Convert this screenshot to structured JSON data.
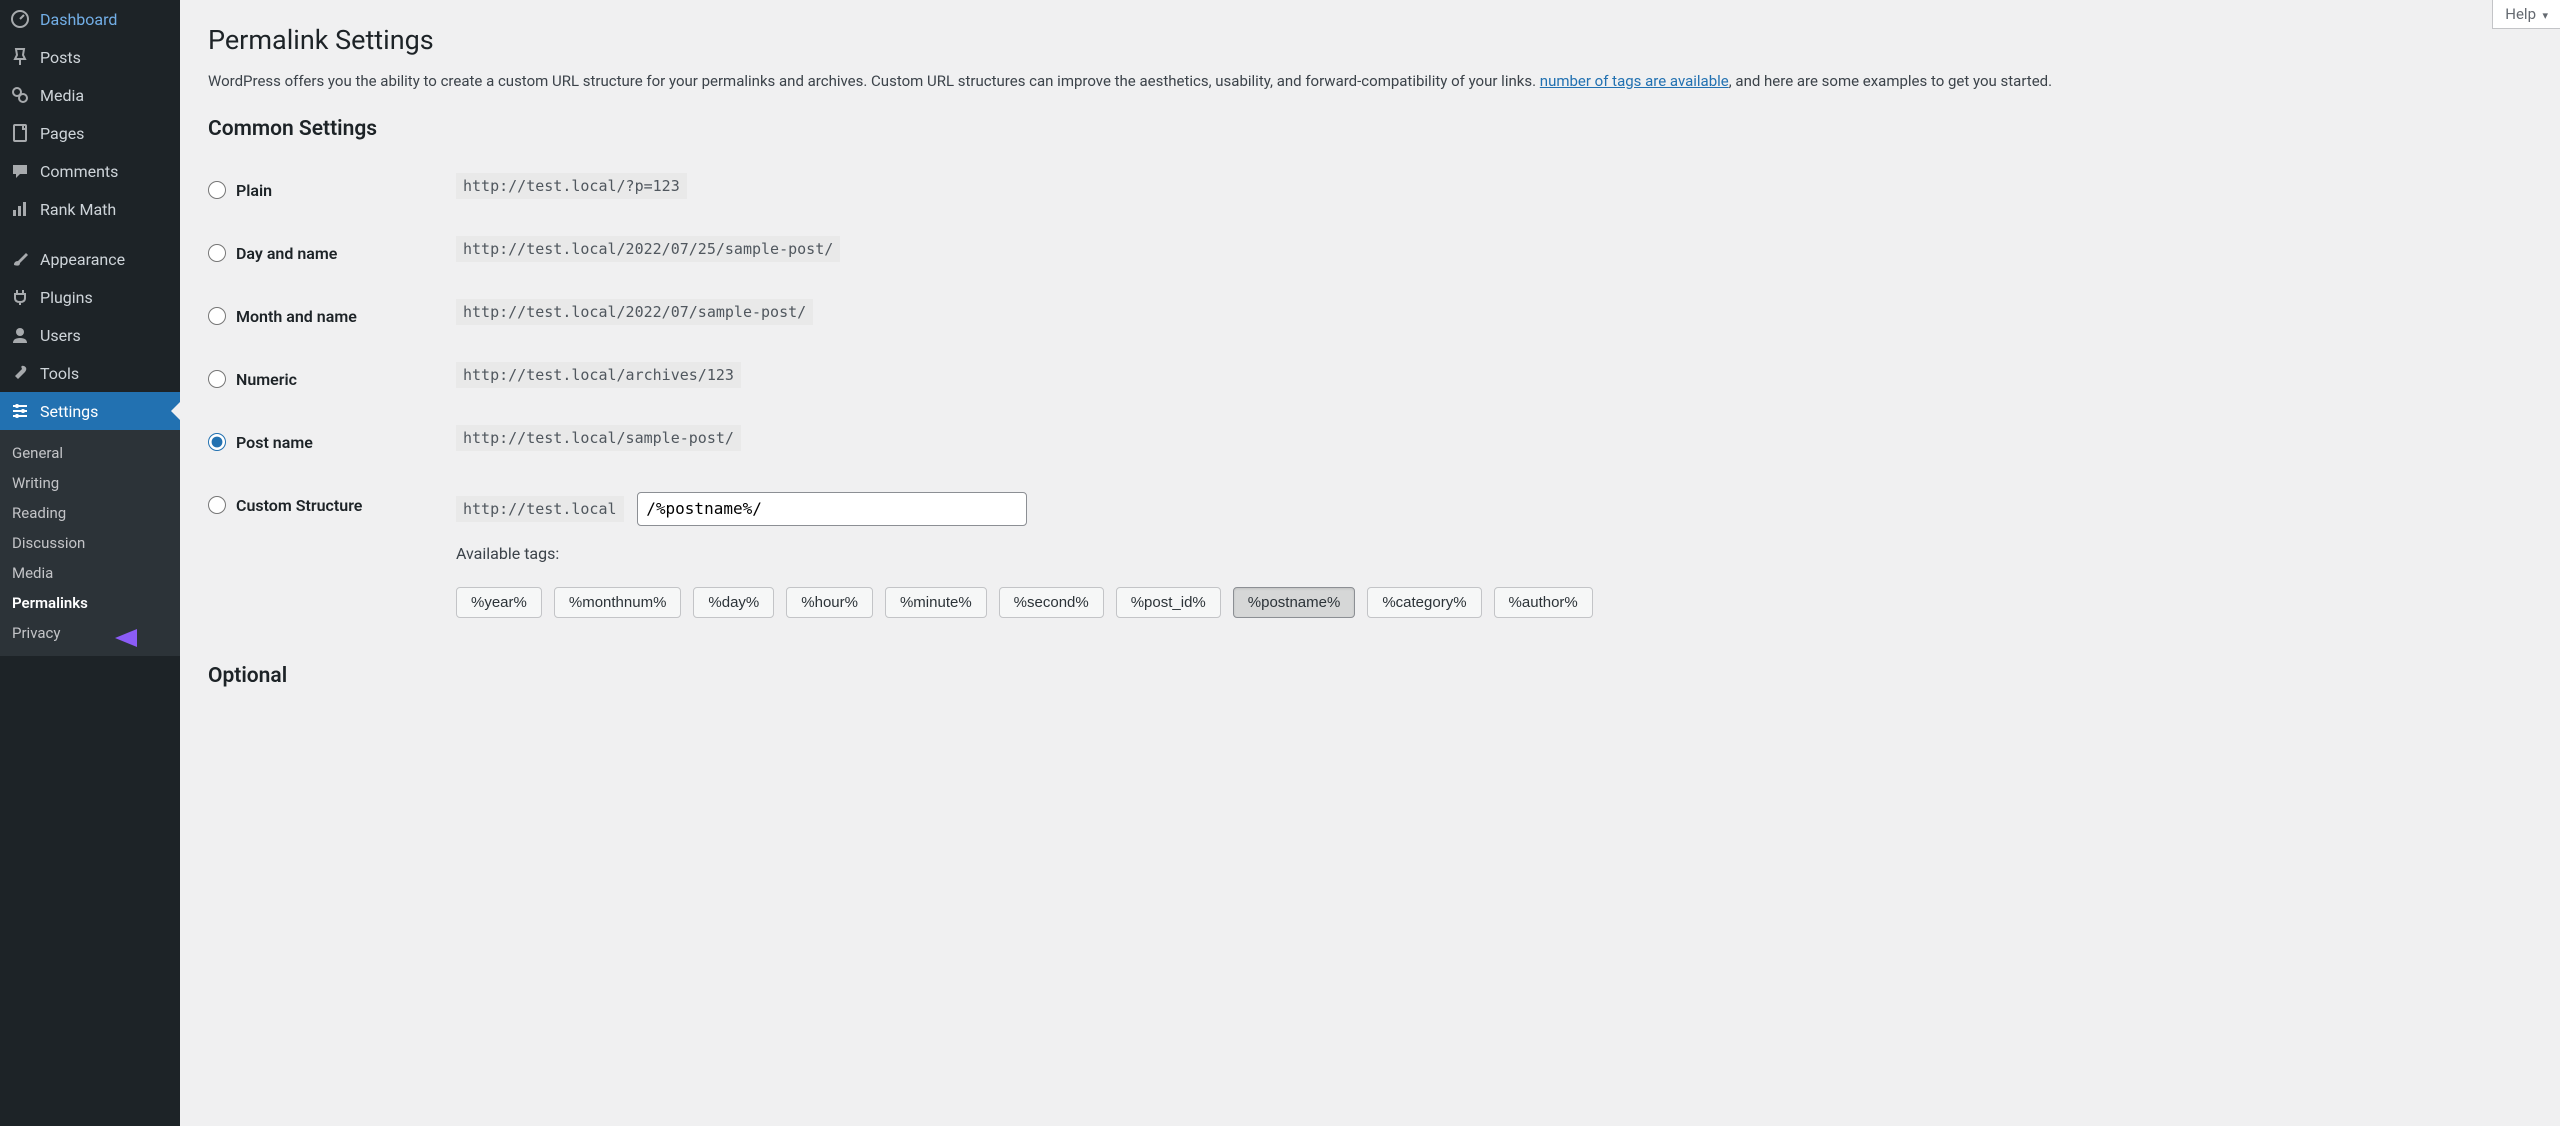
{
  "help_label": "Help",
  "sidebar": {
    "items": [
      {
        "id": "dashboard",
        "label": "Dashboard",
        "icon": "speed"
      },
      {
        "id": "posts",
        "label": "Posts",
        "icon": "pin"
      },
      {
        "id": "media",
        "label": "Media",
        "icon": "media"
      },
      {
        "id": "pages",
        "label": "Pages",
        "icon": "page"
      },
      {
        "id": "comments",
        "label": "Comments",
        "icon": "comment"
      },
      {
        "id": "rankmath",
        "label": "Rank Math",
        "icon": "chart"
      }
    ],
    "items2": [
      {
        "id": "appearance",
        "label": "Appearance",
        "icon": "brush"
      },
      {
        "id": "plugins",
        "label": "Plugins",
        "icon": "plug"
      },
      {
        "id": "users",
        "label": "Users",
        "icon": "user"
      },
      {
        "id": "tools",
        "label": "Tools",
        "icon": "wrench"
      },
      {
        "id": "settings",
        "label": "Settings",
        "icon": "sliders"
      }
    ],
    "settings_sub": [
      {
        "id": "general",
        "label": "General"
      },
      {
        "id": "writing",
        "label": "Writing"
      },
      {
        "id": "reading",
        "label": "Reading"
      },
      {
        "id": "discussion",
        "label": "Discussion"
      },
      {
        "id": "media",
        "label": "Media"
      },
      {
        "id": "permalinks",
        "label": "Permalinks"
      },
      {
        "id": "privacy",
        "label": "Privacy"
      }
    ]
  },
  "page": {
    "title": "Permalink Settings",
    "intro_1": "WordPress offers you the ability to create a custom URL structure for your permalinks and archives. Custom URL structures can improve the aesthetics, usability, and forward-compatibility of your links. ",
    "intro_link": "number of tags are available",
    "intro_2": ", and here are some examples to get you started.",
    "common_heading": "Common Settings",
    "optional_heading": "Optional",
    "available_tags_label": "Available tags:"
  },
  "permalink_options": [
    {
      "id": "plain",
      "label": "Plain",
      "example": "http://test.local/?p=123",
      "selected": false
    },
    {
      "id": "dayname",
      "label": "Day and name",
      "example": "http://test.local/2022/07/25/sample-post/",
      "selected": false
    },
    {
      "id": "monthname",
      "label": "Month and name",
      "example": "http://test.local/2022/07/sample-post/",
      "selected": false
    },
    {
      "id": "numeric",
      "label": "Numeric",
      "example": "http://test.local/archives/123",
      "selected": false
    },
    {
      "id": "postname",
      "label": "Post name",
      "example": "http://test.local/sample-post/",
      "selected": true
    },
    {
      "id": "custom",
      "label": "Custom Structure",
      "example": "http://test.local",
      "selected": false
    }
  ],
  "custom_structure_value": "/%postname%/",
  "tags": [
    {
      "label": "%year%",
      "selected": false
    },
    {
      "label": "%monthnum%",
      "selected": false
    },
    {
      "label": "%day%",
      "selected": false
    },
    {
      "label": "%hour%",
      "selected": false
    },
    {
      "label": "%minute%",
      "selected": false
    },
    {
      "label": "%second%",
      "selected": false
    },
    {
      "label": "%post_id%",
      "selected": false
    },
    {
      "label": "%postname%",
      "selected": true
    },
    {
      "label": "%category%",
      "selected": false
    },
    {
      "label": "%author%",
      "selected": false
    }
  ]
}
